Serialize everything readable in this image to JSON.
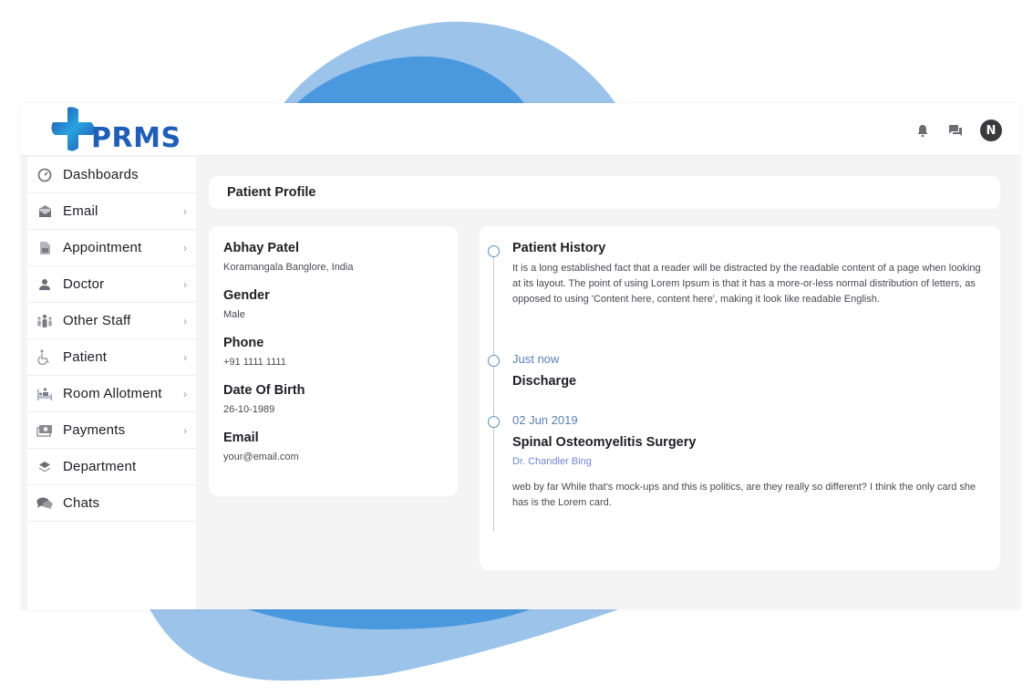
{
  "brand": {
    "name": "PRMS",
    "colors": {
      "primary": "#1f5fb8",
      "accent": "#2aa3e0",
      "blob_light": "#9cc3ea",
      "blob_dark": "#4a98dd"
    }
  },
  "header": {
    "icons": [
      {
        "name": "bell-icon",
        "label": "Notifications"
      },
      {
        "name": "chat-icon",
        "label": "Messages"
      }
    ],
    "avatar_initial": "N"
  },
  "sidebar": {
    "items": [
      {
        "label": "Dashboards",
        "icon": "gauge-icon",
        "has_submenu": false
      },
      {
        "label": "Email",
        "icon": "envelope-icon",
        "has_submenu": true
      },
      {
        "label": "Appointment",
        "icon": "document-icon",
        "has_submenu": true
      },
      {
        "label": "Doctor",
        "icon": "user-icon",
        "has_submenu": true
      },
      {
        "label": "Other Staff",
        "icon": "staff-icon",
        "has_submenu": true
      },
      {
        "label": "Patient",
        "icon": "wheelchair-icon",
        "has_submenu": true
      },
      {
        "label": "Room Allotment",
        "icon": "bed-icon",
        "has_submenu": true
      },
      {
        "label": "Payments",
        "icon": "money-icon",
        "has_submenu": true
      },
      {
        "label": "Department",
        "icon": "layers-icon",
        "has_submenu": false
      },
      {
        "label": "Chats",
        "icon": "chats-icon",
        "has_submenu": false
      }
    ],
    "chevron": "›"
  },
  "page": {
    "title": "Patient Profile"
  },
  "profile": {
    "name": "Abhay Patel",
    "address": "Koramangala Banglore, India",
    "fields": [
      {
        "label": "Gender",
        "value": "Male"
      },
      {
        "label": "Phone",
        "value": "+91 1111 1111"
      },
      {
        "label": "Date Of Birth",
        "value": "26-10-1989"
      },
      {
        "label": "Email",
        "value": "your@email.com"
      }
    ]
  },
  "history": {
    "title": "Patient History",
    "intro": "It is a long established fact that a reader will be distracted by the readable content of a page when looking at its layout. The point of using Lorem Ipsum is that it has a more-or-less normal distribution of letters, as opposed to using 'Content here, content here', making it look like readable English.",
    "events": [
      {
        "date": "Just now",
        "title": "Discharge"
      },
      {
        "date": "02 Jun 2019",
        "title": "Spinal Osteomyelitis Surgery",
        "doctor": "Dr. Chandler Bing",
        "note": "web by far While that's mock-ups and this is politics, are they really so different? I think the only card she has is the Lorem card."
      }
    ]
  }
}
